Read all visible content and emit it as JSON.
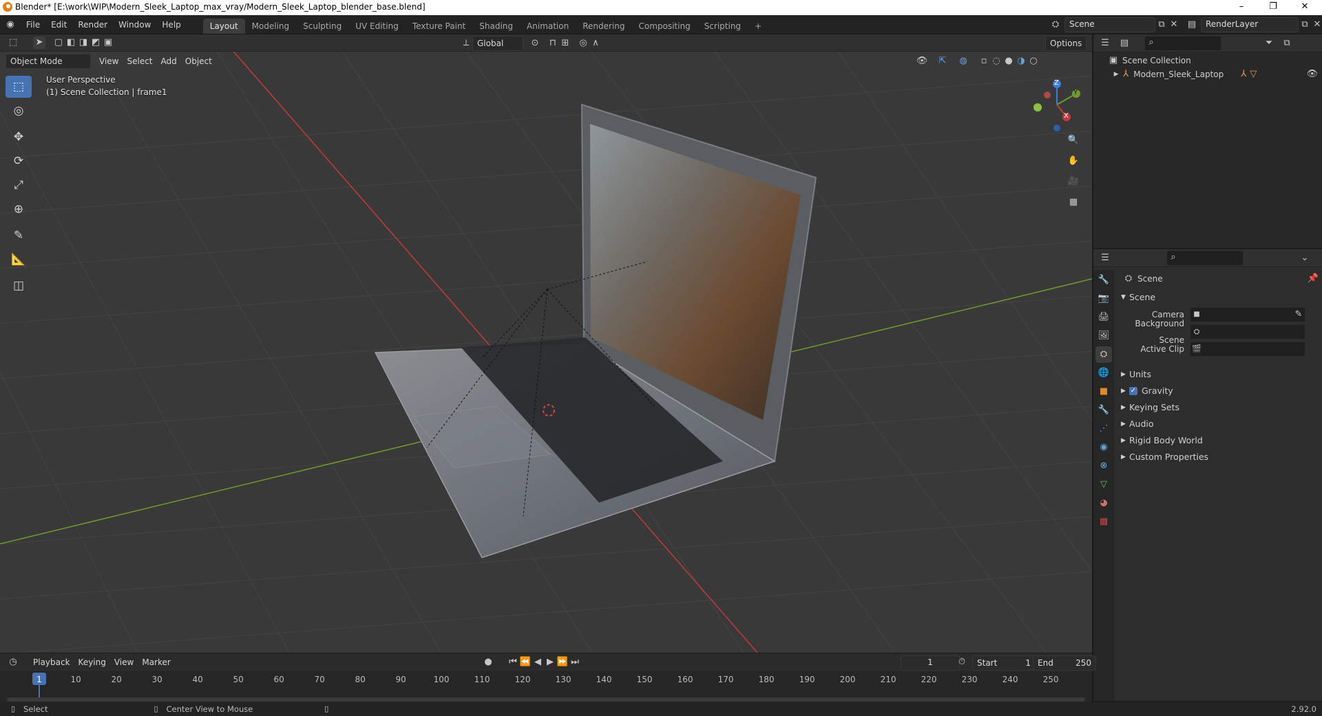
{
  "titlebar": {
    "title": "Blender* [E:\\work\\WIP\\Modern_Sleek_Laptop_max_vray/Modern_Sleek_Laptop_blender_base.blend]",
    "minimize": "–",
    "maximize": "❐",
    "close": "✕"
  },
  "menu": {
    "items": [
      "File",
      "Edit",
      "Render",
      "Window",
      "Help"
    ],
    "workspaces": [
      "Layout",
      "Modeling",
      "Sculpting",
      "UV Editing",
      "Texture Paint",
      "Shading",
      "Animation",
      "Rendering",
      "Compositing",
      "Scripting"
    ],
    "add_workspace": "+",
    "scene_name": "Scene",
    "view_layer": "RenderLayer"
  },
  "viewport_header": {
    "mode": "Object Mode",
    "menus": [
      "View",
      "Select",
      "Add",
      "Object"
    ],
    "orientation": "Global",
    "options": "Options"
  },
  "viewport": {
    "perspective": "User Perspective",
    "collection_info": "(1) Scene Collection | frame1",
    "gizmo_labels": {
      "z": "Z",
      "y": "Y",
      "x": "X"
    }
  },
  "outliner": {
    "root": "Scene Collection",
    "items": [
      {
        "name": "Modern_Sleek_Laptop"
      }
    ]
  },
  "properties": {
    "context": "Scene",
    "section": "Scene",
    "fields": [
      {
        "label": "Camera"
      },
      {
        "label": "Background Scene"
      },
      {
        "label": "Active Clip"
      }
    ],
    "panels": [
      {
        "label": "Units",
        "checkbox": false
      },
      {
        "label": "Gravity",
        "checkbox": true
      },
      {
        "label": "Keying Sets",
        "checkbox": false
      },
      {
        "label": "Audio",
        "checkbox": false
      },
      {
        "label": "Rigid Body World",
        "checkbox": false
      },
      {
        "label": "Custom Properties",
        "checkbox": false
      }
    ],
    "tab_colors": [
      "#c8c8c8",
      "#c8c8c8",
      "#c8c8c8",
      "#c8c8c8",
      "#c8c8c8",
      "#d06060",
      "#e08a2c",
      "#4f8ed6",
      "#6aa0d8",
      "#60a8e0",
      "#6ab0e8",
      "#6cc05a",
      "#d0706a",
      "#c04848"
    ]
  },
  "timeline": {
    "menus": [
      "Playback",
      "Keying",
      "View",
      "Marker"
    ],
    "current_frame": "1",
    "start_label": "Start",
    "start": "1",
    "end_label": "End",
    "end": "250",
    "ticks": [
      "1",
      "10",
      "20",
      "30",
      "40",
      "50",
      "60",
      "70",
      "80",
      "90",
      "100",
      "110",
      "120",
      "130",
      "140",
      "150",
      "160",
      "170",
      "180",
      "190",
      "200",
      "210",
      "220",
      "230",
      "240",
      "250"
    ]
  },
  "statusbar": {
    "select": "Select",
    "center_view": "Center View to Mouse",
    "version": "2.92.0"
  },
  "colors": {
    "accent": "#4772b3",
    "x_axis": "#c23a3a",
    "y_axis": "#6f9c2b",
    "z_axis": "#3a7fdb"
  }
}
